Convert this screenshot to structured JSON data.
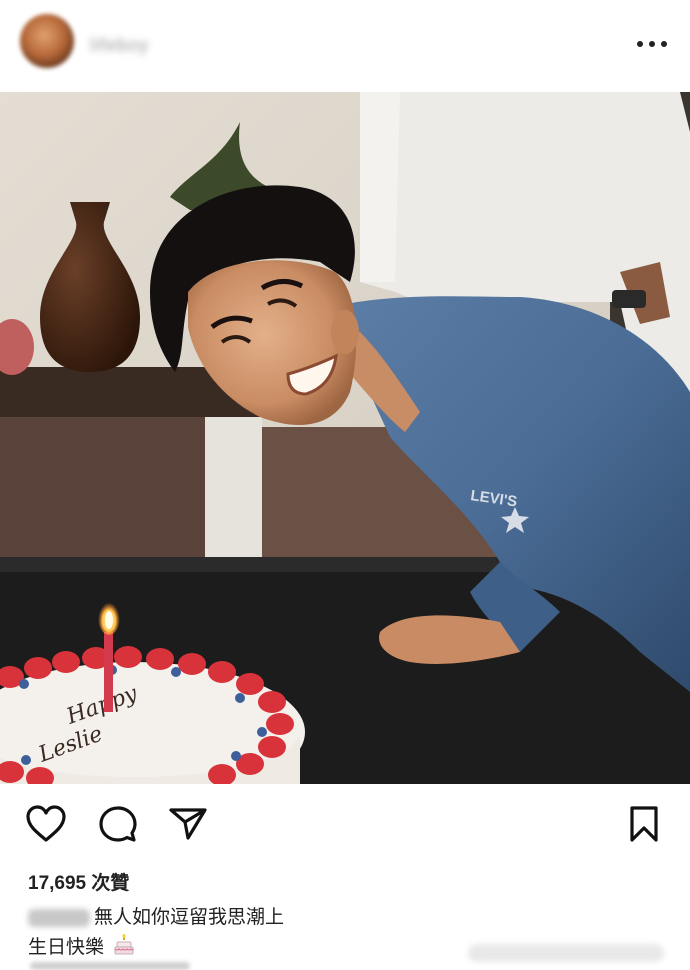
{
  "header": {
    "username": "lifeboy",
    "more_icon": "more-horizontal-icon"
  },
  "actions": {
    "like_icon": "heart-icon",
    "comment_icon": "comment-bubble-icon",
    "share_icon": "send-paper-plane-icon",
    "save_icon": "bookmark-icon"
  },
  "post": {
    "likes_text": "17,695 次贊",
    "caption_line1": "無人如你逗留我思潮上",
    "caption_line2": "生日快樂"
  },
  "colors": {
    "icon": "#111111",
    "text": "#222222",
    "shirt": "#4b6f98",
    "candle": "#d33a4d"
  }
}
